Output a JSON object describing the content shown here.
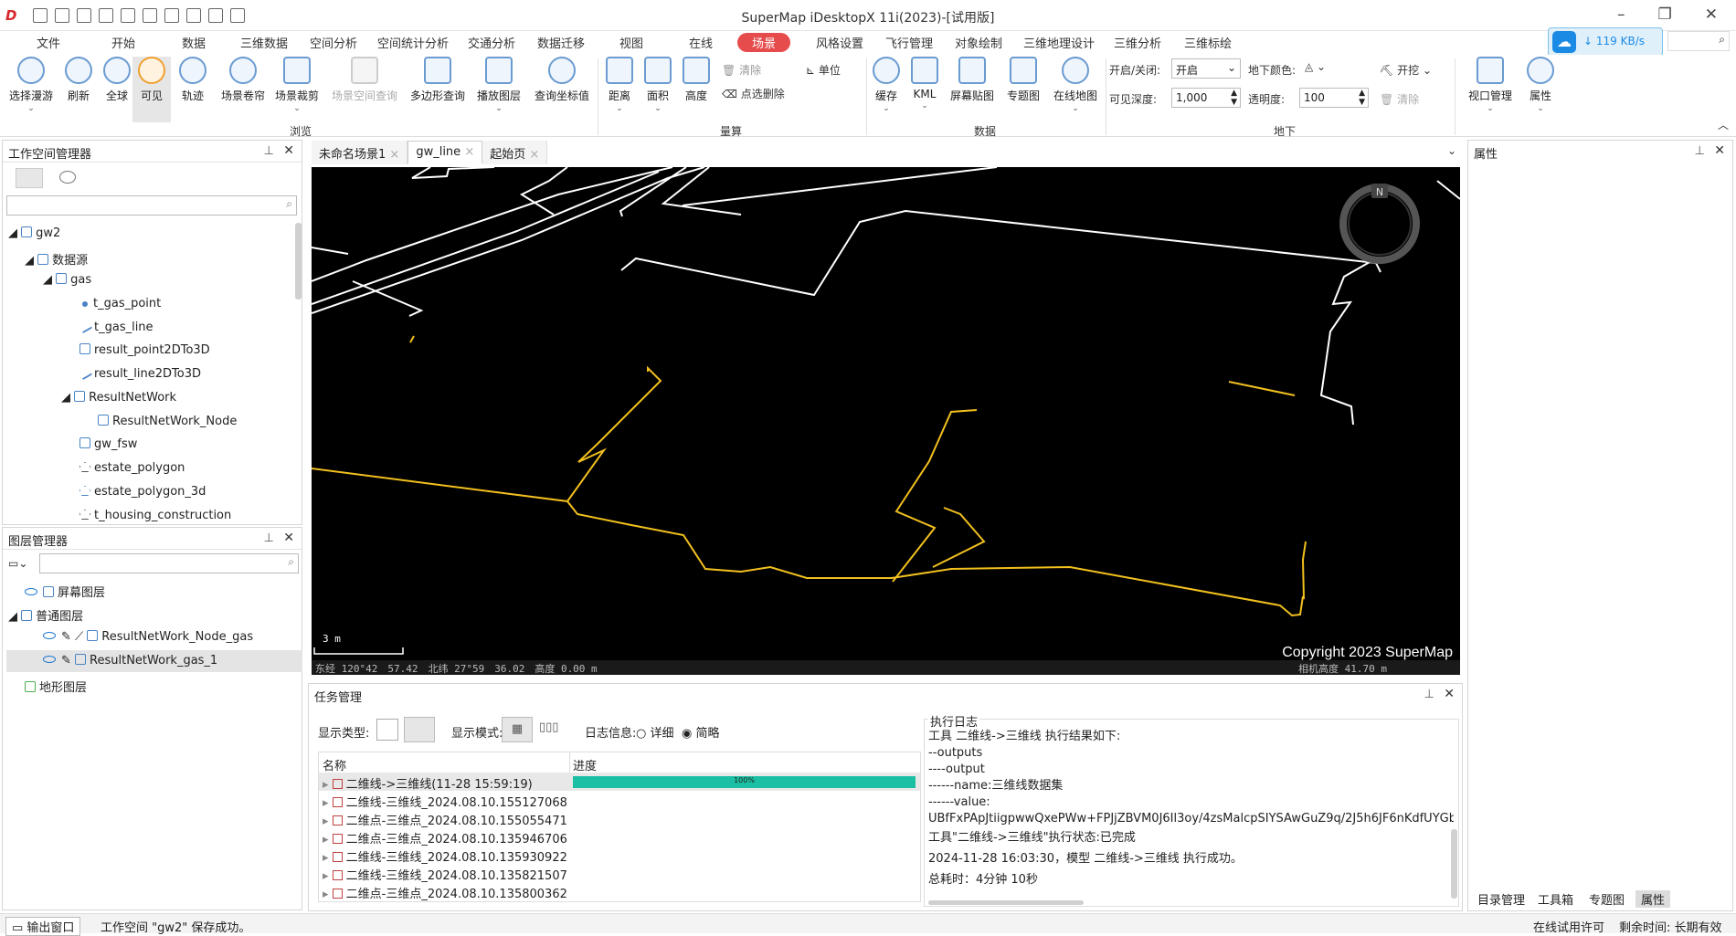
{
  "app": {
    "title": "SuperMap iDesktopX 11i(2023)-[试用版]",
    "net_speed": "119 KB/s"
  },
  "menu": [
    "文件",
    "开始",
    "数据",
    "三维数据",
    "空间分析",
    "空间统计分析",
    "交通分析",
    "数据迁移",
    "视图",
    "在线",
    "场景",
    "风格设置",
    "飞行管理",
    "对象绘制",
    "三维地理设计",
    "三维分析",
    "三维标绘"
  ],
  "menu_active": "场景",
  "ribbon": {
    "browse": [
      "选择漫游",
      "刷新",
      "全球",
      "可见",
      "轨迹",
      "场景卷帘",
      "场景裁剪",
      "场景空间查询",
      "多边形查询",
      "播放图层",
      "查询坐标值"
    ],
    "browse_group": "浏览",
    "measure": [
      "距离",
      "面积",
      "高度"
    ],
    "measure_small": [
      "清除",
      "点选删除",
      "单位"
    ],
    "measure_group": "量算",
    "data": [
      "缓存",
      "KML",
      "屏幕贴图",
      "专题图",
      "在线地图"
    ],
    "data_group": "数据",
    "underground": {
      "switch_label": "开启/关闭:",
      "switch_value": "开启",
      "color_label": "地下颜色:",
      "excavate": "开挖",
      "depth_label": "可见深度:",
      "depth_value": "1,000",
      "opacity_label": "透明度:",
      "opacity_value": "100",
      "clear": "清除",
      "group": "地下"
    },
    "view": [
      "视口管理",
      "属性"
    ]
  },
  "workspace": {
    "title": "工作空间管理器",
    "items": [
      "gw2",
      "数据源",
      "gas",
      "t_gas_point",
      "t_gas_line",
      "result_point2DTo3D",
      "result_line2DTo3D",
      "ResultNetWork",
      "ResultNetWork_Node",
      "gw_fsw",
      "estate_polygon",
      "estate_polygon_3d",
      "t_housing_construction"
    ]
  },
  "layers": {
    "title": "图层管理器",
    "items": [
      "屏幕图层",
      "普通图层",
      "ResultNetWork_Node_gas",
      "ResultNetWork_gas_1",
      "地形图层"
    ]
  },
  "tabs": [
    "未命名场景1",
    "gw_line",
    "起始页"
  ],
  "scene": {
    "scale": "3 m",
    "copyright": "Copyright 2023 SuperMap",
    "coords": "东经 120°42　57.42　北纬 27°59　36.02　高度 0.00 m",
    "camera": "相机高度 41.70 m",
    "compass": "N"
  },
  "properties": {
    "title": "属性"
  },
  "tasks": {
    "title": "任务管理",
    "show_type": "显示类型:",
    "show_mode": "显示模式:",
    "log_info": "日志信息:",
    "detail": "详细",
    "brief": "简略",
    "col_name": "名称",
    "col_progress": "进度",
    "progress": 1,
    "progress_text": "100%",
    "rows": [
      "二维线->三维线(11-28 15:59:19)",
      "二维线-三维线_2024.08.10.155127068",
      "二维点-三维点_2024.08.10.155055471",
      "二维点-三维点_2024.08.10.135946706",
      "二维线-三维线_2024.08.10.135930922",
      "二维线-三维线_2024.08.10.135821507",
      "二维点-三维点_2024.08.10.135800362"
    ],
    "log_title": "执行日志",
    "log": [
      "工具 二维线->三维线 执行结果如下:",
      "--outputs",
      "----output",
      "------name:三维线数据集",
      "------value:",
      "UBfFxPApJtiigpwwQxePWw+FPJjZBVM0J6Il3oy/4zsMalcpSIYSAwGuZ9q/2J5h6JF6nKdfUYGbC",
      "工具\"二维线->三维线\"执行状态:已完成",
      "2024-11-28 16:03:30，模型 二维线->三维线 执行成功。",
      "总耗时：4分钟 10秒"
    ]
  },
  "right_tabs": [
    "目录管理",
    "工具箱",
    "专题图",
    "属性"
  ],
  "status": {
    "output": "输出窗口",
    "message": "工作空间 \"gw2\" 保存成功。",
    "license": "在线试用许可",
    "remaining": "剩余时间: 长期有效"
  },
  "colors": {
    "accent": "#e74c4c",
    "progress": "#1bbfa3",
    "pipe_yellow": "#f2c01e",
    "scene_bg": "#000000"
  }
}
